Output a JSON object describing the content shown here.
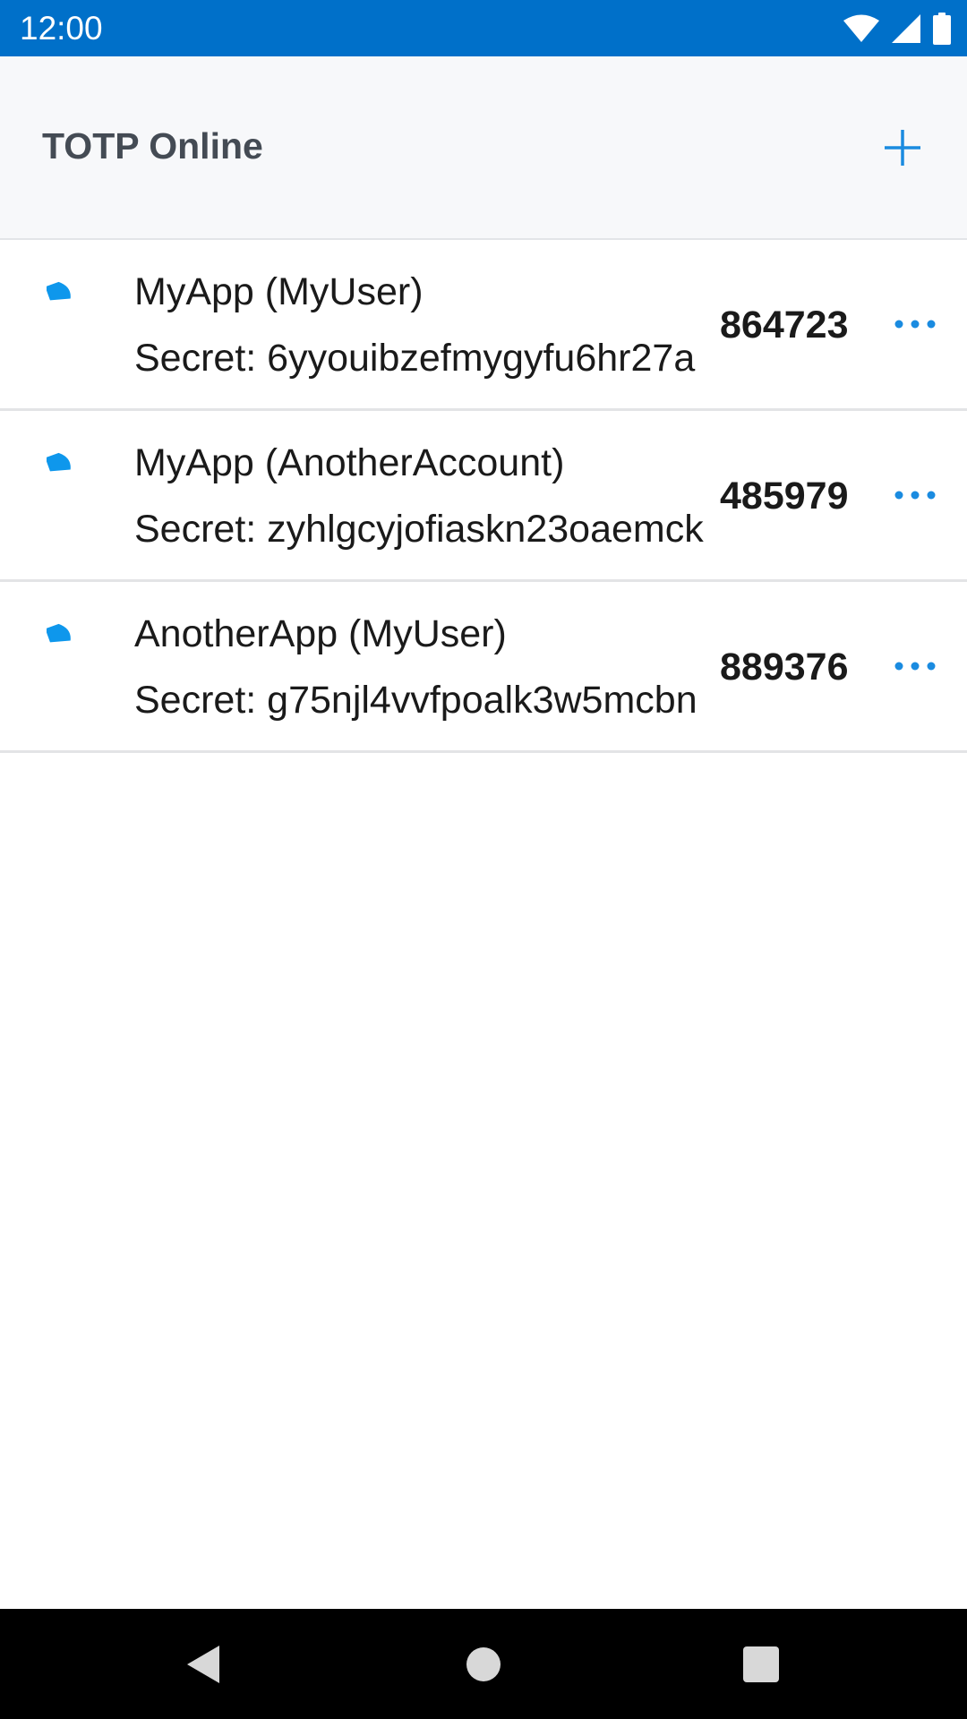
{
  "status_bar": {
    "time": "12:00",
    "icons": [
      "wifi-icon",
      "signal-icon",
      "battery-icon"
    ]
  },
  "app": {
    "title": "TOTP Online",
    "add_icon": "plus-icon",
    "accent_color": "#1a8be0"
  },
  "accounts": [
    {
      "name": "MyApp (MyUser)",
      "secret": "Secret: 6yyouibzefmygyfu6hr27a",
      "code": "864723",
      "timer_icon": "countdown-timer-icon",
      "more_icon": "more-horizontal-icon"
    },
    {
      "name": "MyApp (AnotherAccount)",
      "secret": "Secret: zyhlgcyjofiaskn23oaemck",
      "code": "485979",
      "timer_icon": "countdown-timer-icon",
      "more_icon": "more-horizontal-icon"
    },
    {
      "name": "AnotherApp (MyUser)",
      "secret": "Secret: g75njl4vvfpoalk3w5mcbn",
      "code": "889376",
      "timer_icon": "countdown-timer-icon",
      "more_icon": "more-horizontal-icon"
    }
  ],
  "nav_bar": {
    "buttons": [
      "back-icon",
      "home-icon",
      "recents-icon"
    ]
  }
}
